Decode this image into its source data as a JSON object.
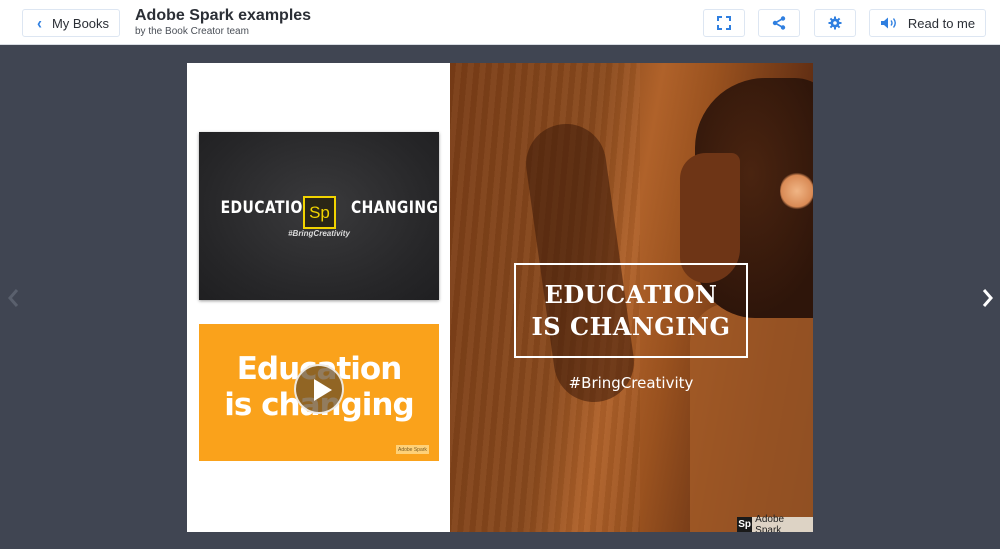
{
  "header": {
    "back_label": "My Books",
    "title": "Adobe Spark examples",
    "subtitle": "by the Book Creator team",
    "read_label": "Read to me",
    "icons": {
      "back": "chevron-left-icon",
      "fullscreen": "fullscreen-icon",
      "share": "share-icon",
      "settings": "gear-icon",
      "read": "speaker-icon"
    }
  },
  "navigation": {
    "prev": "chevron-left-icon",
    "next": "chevron-right-icon"
  },
  "left_page": {
    "card1": {
      "title_left": "EDUCATION",
      "logo": "Sp",
      "title_right": "CHANGING",
      "subtitle": "#BringCreativity"
    },
    "card2": {
      "title_line1": "Education",
      "title_line2": "is changing",
      "badge": "Adobe Spark"
    }
  },
  "right_page": {
    "headline_line1": "EDUCATION",
    "headline_line2": "IS CHANGING",
    "hashtag": "#BringCreativity",
    "badge_logo": "Sp",
    "badge_label": "Adobe Spark"
  },
  "colors": {
    "accent": "#2f7fe0",
    "background": "#404552",
    "card_yellow": "#faa21b",
    "spark_yellow": "#f2d400"
  }
}
